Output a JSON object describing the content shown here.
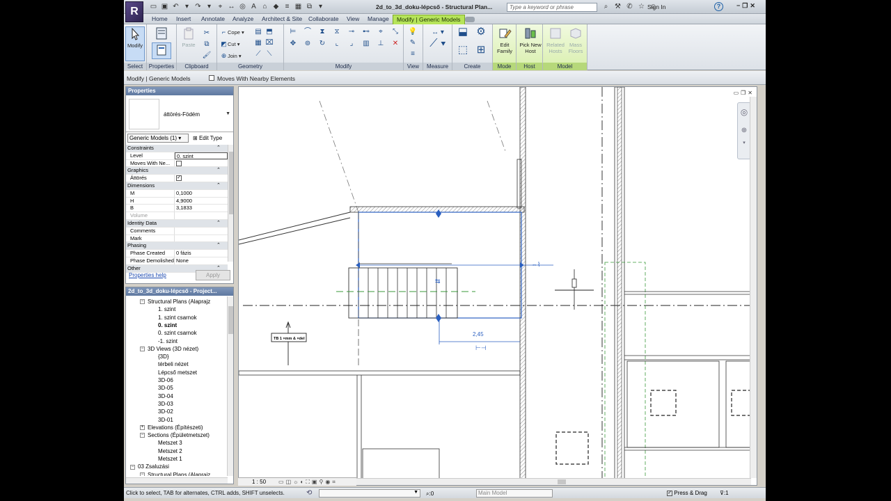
{
  "app": {
    "logo": "R",
    "document_title": "2d_to_3d_doku-lépcső - Structural Plan...",
    "search_placeholder": "Type a keyword or phrase",
    "signin": "Sign In"
  },
  "ribbon_tabs": [
    "Home",
    "Insert",
    "Annotate",
    "Analyze",
    "Architect & Site",
    "Collaborate",
    "View",
    "Manage",
    "Modify | Generic Models"
  ],
  "ribbon": {
    "select": {
      "label": "Select",
      "modify_btn": "Modify"
    },
    "properties": {
      "label": "Properties"
    },
    "clipboard": {
      "label": "Clipboard",
      "paste": "Paste"
    },
    "geometry": {
      "label": "Geometry",
      "cope": "Cope",
      "cut": "Cut",
      "join": "Join"
    },
    "modify": {
      "label": "Modify"
    },
    "view": {
      "label": "View"
    },
    "measure": {
      "label": "Measure"
    },
    "create": {
      "label": "Create"
    },
    "mode": {
      "label": "Mode",
      "edit_family": "Edit Family"
    },
    "host": {
      "label": "Host",
      "pick_new_host": "Pick New Host"
    },
    "model": {
      "label": "Model",
      "related_hosts": "Related Hosts",
      "mass_floors": "Mass Floors"
    }
  },
  "options_bar": {
    "context": "Modify | Generic Models",
    "checkbox_label": "Moves With Nearby Elements",
    "checkbox_checked": false
  },
  "properties": {
    "title": "Properties",
    "type_name": "áttörés-Födém",
    "instance_selector": "Generic Models (1)",
    "edit_type": "Edit Type",
    "rows": [
      {
        "group": true,
        "name": "Constraints"
      },
      {
        "name": "Level",
        "value": "0. szint",
        "edit": true
      },
      {
        "name": "Moves With Ne...",
        "checkbox": true,
        "checked": false
      },
      {
        "group": true,
        "name": "Graphics"
      },
      {
        "name": "Áttörés",
        "checkbox": true,
        "checked": true
      },
      {
        "group": true,
        "name": "Dimensions"
      },
      {
        "name": "M",
        "value": "0,1000"
      },
      {
        "name": "H",
        "value": "4,9000"
      },
      {
        "name": "B",
        "value": "3,1833"
      },
      {
        "name": "Volume",
        "value": "",
        "dim": true
      },
      {
        "group": true,
        "name": "Identity Data"
      },
      {
        "name": "Comments",
        "value": ""
      },
      {
        "name": "Mark",
        "value": ""
      },
      {
        "group": true,
        "name": "Phasing"
      },
      {
        "name": "Phase Created",
        "value": "0 fázis"
      },
      {
        "name": "Phase Demolished",
        "value": "None"
      },
      {
        "group": true,
        "name": "Other"
      }
    ],
    "help_link": "Properties help",
    "apply": "Apply"
  },
  "browser": {
    "title": "2d_to_3d_doku-lépcső - Project...",
    "nodes": [
      {
        "text": "Structural Plans (Alaprajz",
        "indent": 1,
        "expander": "−"
      },
      {
        "text": "1. szint",
        "indent": 2
      },
      {
        "text": "1. szint csarnok",
        "indent": 2
      },
      {
        "text": "0. szint",
        "indent": 2,
        "selected": true
      },
      {
        "text": "0. szint csarnok",
        "indent": 2
      },
      {
        "text": "-1. szint",
        "indent": 2
      },
      {
        "text": "3D Views (3D nézet)",
        "indent": 1,
        "expander": "−"
      },
      {
        "text": "{3D}",
        "indent": 2
      },
      {
        "text": "térbeli nézet",
        "indent": 2
      },
      {
        "text": "Lépcső metszet",
        "indent": 2
      },
      {
        "text": "3D-06",
        "indent": 2
      },
      {
        "text": "3D-05",
        "indent": 2
      },
      {
        "text": "3D-04",
        "indent": 2
      },
      {
        "text": "3D-03",
        "indent": 2
      },
      {
        "text": "3D-02",
        "indent": 2
      },
      {
        "text": "3D-01",
        "indent": 2
      },
      {
        "text": "Elevations (Építészeti)",
        "indent": 1,
        "expander": "+"
      },
      {
        "text": "Sections (Épületmetszet)",
        "indent": 1,
        "expander": "−"
      },
      {
        "text": "Metszet 3",
        "indent": 2
      },
      {
        "text": "Metszet 2",
        "indent": 2
      },
      {
        "text": "Metszet 1",
        "indent": 2
      },
      {
        "text": "03 Zsaluzási",
        "indent": 0,
        "expander": "−"
      },
      {
        "text": "Structural Plans (Alaprajz",
        "indent": 1,
        "expander": "−"
      }
    ]
  },
  "view": {
    "dimension_value": "2,45",
    "tag_text": "TB 1 ×mm & ×del",
    "scale": "1 : 50"
  },
  "status": {
    "hint": "Click to select, TAB for alternates, CTRL adds, SHIFT unselects.",
    "zero": ":0",
    "model": "Main Model",
    "press_drag": "Press & Drag",
    "filter": ":1"
  }
}
